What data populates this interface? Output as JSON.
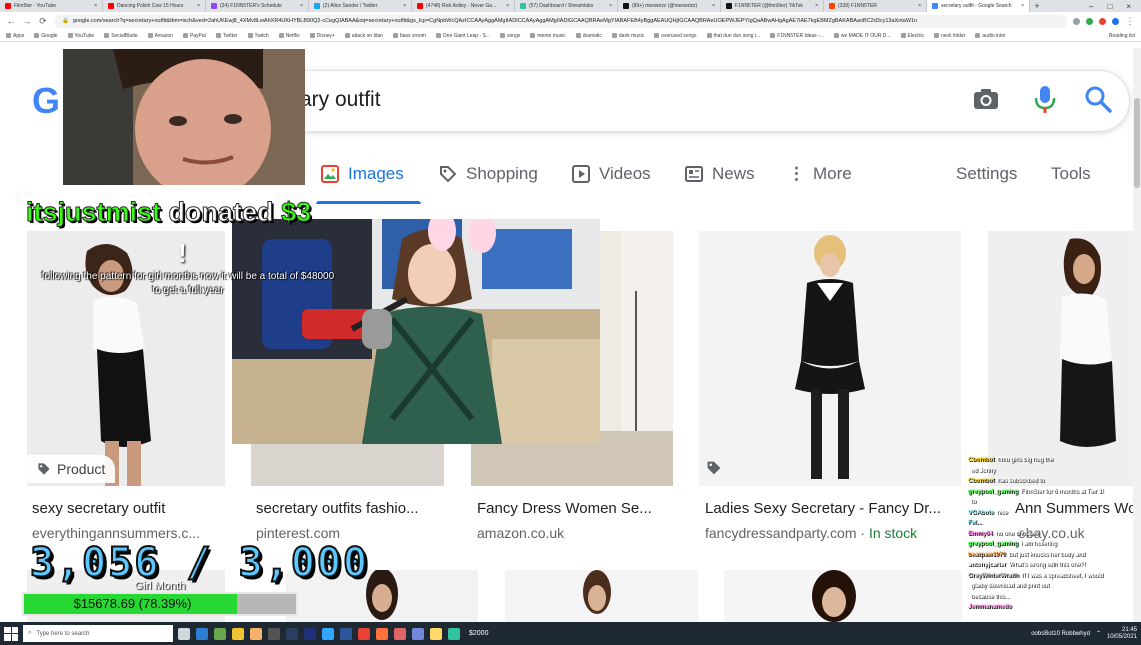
{
  "browser": {
    "tabs": [
      {
        "title": "Film5ter - YouTube",
        "color": "#ff0000"
      },
      {
        "title": "Dancing Polish Cow 15 Hours",
        "color": "#ff0000"
      },
      {
        "title": "(24) F1NN5TER's Schedule",
        "color": "#9146ff"
      },
      {
        "title": "(2) Alice Sander / Twitter",
        "color": "#1da1f2"
      },
      {
        "title": "(4748) Rick Astley - Never Go...",
        "color": "#ff0000"
      },
      {
        "title": "(57) Dashboard / Streamlabs",
        "color": "#31c3a2"
      },
      {
        "title": "(89+) meowrizz (@meowrizz)",
        "color": "#111111"
      },
      {
        "title": "F1NN5TER (@finn5ter) TikTok",
        "color": "#111111"
      },
      {
        "title": "(328) F1NN5TER",
        "color": "#ff4500"
      },
      {
        "title": "secretary outfit - Google Search",
        "color": "#4285f4",
        "active": true
      }
    ],
    "url": "google.com/search?q=secretary+outfit&tbm=isch&ved=2ahUKEwj8_4XMv8LwAhXR4UKHYBLB90Q2-cCegQIABAA&oq=secretary+outfit&gs_lcp=CgNpbWcQAzICCAAyAggAMgIIADICCAAyAggAMgIIADIGCAAQBRAeMgYIABAFEB4yBggAEAUQHjIGCAAQBRAeUOEPWJEPYIgQaABwAHgAgAE7iAE7kgEBMZgBAKABAaoBC2d3cy13aXotaW1n",
    "bookmarks": [
      "Apps",
      "Google",
      "YouTube",
      "SocialBlade",
      "Amazon",
      "PayPal",
      "Twitter",
      "Twitch",
      "Netflix",
      "Disney+",
      "attack on titan",
      "bass vroom",
      "One Giant Leap - S...",
      "songs",
      "meme music",
      "dramatic",
      "dank music",
      "overused songs",
      "that dun dun song i...",
      "F1NN5TER Ideas -...",
      "we MADE IT OUR D...",
      "Electric",
      "neck folder",
      "audio inter"
    ],
    "bookmarks_right": "Reading list"
  },
  "search": {
    "query": "ary outfit",
    "tabs": [
      {
        "label": "Images",
        "active": true
      },
      {
        "label": "Shopping"
      },
      {
        "label": "Videos"
      },
      {
        "label": "News"
      },
      {
        "label": "More"
      }
    ],
    "settings": "Settings",
    "tools": "Tools"
  },
  "results": [
    {
      "title": "sexy secretary outfit",
      "source": "everythingannsummers.c..."
    },
    {
      "title": "secretary outfits fashio...",
      "source": "pinterest.com"
    },
    {
      "title": "Fancy Dress Women Se...",
      "source": "amazon.co.uk"
    },
    {
      "title": "Ladies Sexy Secretary - Fancy Dr...",
      "source": "fancydressandparty.com",
      "extra": "In stock"
    },
    {
      "title": "Ann Summers Won...",
      "source": "ebay.co.uk"
    }
  ],
  "product_badge": "Product",
  "overlay": {
    "donor": "itsjustmist",
    "donated_word": "donated",
    "amount": "$3",
    "exclaim": "!",
    "message": "following the pattern for girl months now it will be a total of $48000 to get a full year",
    "goal_count": "3,056 / 3,000",
    "goal_title": "Girl Month",
    "goal_amount": "$15678.69 (78.39%)",
    "goal_fraction": 0.7839
  },
  "chat": [
    {
      "user": "Cbombot",
      "msg": "hmu girls big hug the",
      "color": "#ffd400"
    },
    {
      "user": "",
      "msg": "ed Jonny",
      "color": "#ffd400"
    },
    {
      "user": "Cbombot",
      "msg": "has subscribed to",
      "color": "#ffd400"
    },
    {
      "user": "greypool_gaming",
      "msg": "FlnnSter for 6 months at Tier 1!",
      "color": "#5cff5c"
    },
    {
      "user": "",
      "msg": "to",
      "color": "#5cff5c"
    },
    {
      "user": "VGAbote",
      "msg": "nice",
      "color": "#7df9ff"
    },
    {
      "user": "Fel...",
      "msg": "",
      "color": "#7df9ff"
    },
    {
      "user": "Emmy64",
      "msg": "no one chooses",
      "color": "#ff8de0"
    },
    {
      "user": "greypool_gaming",
      "msg": "i am hollering",
      "color": "#5cff5c"
    },
    {
      "user": "bearpaw1970",
      "msg": "but just knocks her body and",
      "color": "#ffa94d"
    },
    {
      "user": "antonyjcarter",
      "msg": "What's wrong with this one?!",
      "color": "#ffffff"
    },
    {
      "user": "GreyWinterWraith",
      "msg": "If I was a spreadsheet, I would",
      "color": "#cfcfcf"
    },
    {
      "user": "",
      "msg": "gladly download and print out",
      "color": "#cfcfcf"
    },
    {
      "user": "",
      "msg": "because this...",
      "color": "#cfcfcf"
    },
    {
      "user": "Jemmanamedo",
      "msg": "",
      "color": "#ff8de0"
    }
  ],
  "taskbar": {
    "search_placeholder": "Type here to search",
    "icons": [
      "task-view",
      "edge",
      "minecraft",
      "sticky",
      "explorer",
      "obs",
      "steam",
      "vegas",
      "photoshop",
      "word",
      "chrome",
      "firefox",
      "paint",
      "discord",
      "files",
      "streamlabs"
    ],
    "icon_colors": [
      "#cfd8dc",
      "#2d7dd2",
      "#6aa84f",
      "#f1c232",
      "#f6b26b",
      "#555555",
      "#2a3f5f",
      "#1f2f7a",
      "#31a8ff",
      "#2b579a",
      "#ea4335",
      "#ff7139",
      "#e06666",
      "#7289da",
      "#ffd966",
      "#31c3a2"
    ],
    "stream_label": "$2000",
    "tray_text": "oobsBot10 Robbwhyd",
    "time": "21:45",
    "date": "10/05/2021"
  }
}
